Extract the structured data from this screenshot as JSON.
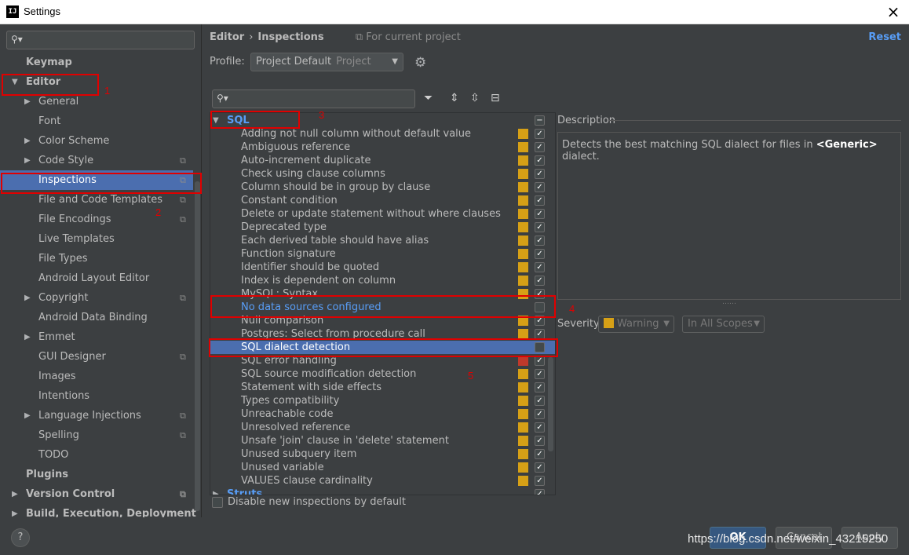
{
  "window": {
    "title": "Settings",
    "app_icon_text": "IJ",
    "close_label": "×"
  },
  "sidebar": {
    "items": [
      {
        "label": "Keymap",
        "level": 0,
        "bold": true,
        "arrow": "",
        "copy": false,
        "selected": false
      },
      {
        "label": "Editor",
        "level": 0,
        "bold": true,
        "arrow": "▼",
        "copy": false,
        "selected": false
      },
      {
        "label": "General",
        "level": 1,
        "bold": false,
        "arrow": "▶",
        "copy": false,
        "selected": false
      },
      {
        "label": "Font",
        "level": 1,
        "bold": false,
        "arrow": "",
        "copy": false,
        "selected": false
      },
      {
        "label": "Color Scheme",
        "level": 1,
        "bold": false,
        "arrow": "▶",
        "copy": false,
        "selected": false
      },
      {
        "label": "Code Style",
        "level": 1,
        "bold": false,
        "arrow": "▶",
        "copy": true,
        "selected": false
      },
      {
        "label": "Inspections",
        "level": 1,
        "bold": false,
        "arrow": "",
        "copy": true,
        "selected": true
      },
      {
        "label": "File and Code Templates",
        "level": 1,
        "bold": false,
        "arrow": "",
        "copy": true,
        "selected": false
      },
      {
        "label": "File Encodings",
        "level": 1,
        "bold": false,
        "arrow": "",
        "copy": true,
        "selected": false
      },
      {
        "label": "Live Templates",
        "level": 1,
        "bold": false,
        "arrow": "",
        "copy": false,
        "selected": false
      },
      {
        "label": "File Types",
        "level": 1,
        "bold": false,
        "arrow": "",
        "copy": false,
        "selected": false
      },
      {
        "label": "Android Layout Editor",
        "level": 1,
        "bold": false,
        "arrow": "",
        "copy": false,
        "selected": false
      },
      {
        "label": "Copyright",
        "level": 1,
        "bold": false,
        "arrow": "▶",
        "copy": true,
        "selected": false
      },
      {
        "label": "Android Data Binding",
        "level": 1,
        "bold": false,
        "arrow": "",
        "copy": false,
        "selected": false
      },
      {
        "label": "Emmet",
        "level": 1,
        "bold": false,
        "arrow": "▶",
        "copy": false,
        "selected": false
      },
      {
        "label": "GUI Designer",
        "level": 1,
        "bold": false,
        "arrow": "",
        "copy": true,
        "selected": false
      },
      {
        "label": "Images",
        "level": 1,
        "bold": false,
        "arrow": "",
        "copy": false,
        "selected": false
      },
      {
        "label": "Intentions",
        "level": 1,
        "bold": false,
        "arrow": "",
        "copy": false,
        "selected": false
      },
      {
        "label": "Language Injections",
        "level": 1,
        "bold": false,
        "arrow": "▶",
        "copy": true,
        "selected": false
      },
      {
        "label": "Spelling",
        "level": 1,
        "bold": false,
        "arrow": "",
        "copy": true,
        "selected": false
      },
      {
        "label": "TODO",
        "level": 1,
        "bold": false,
        "arrow": "",
        "copy": false,
        "selected": false
      },
      {
        "label": "Plugins",
        "level": 0,
        "bold": true,
        "arrow": "",
        "copy": false,
        "selected": false
      },
      {
        "label": "Version Control",
        "level": 0,
        "bold": true,
        "arrow": "▶",
        "copy": true,
        "selected": false
      },
      {
        "label": "Build, Execution, Deployment",
        "level": 0,
        "bold": true,
        "arrow": "▶",
        "copy": false,
        "selected": false
      }
    ]
  },
  "header": {
    "crumb_editor": "Editor",
    "crumb_sep": "›",
    "crumb_inspections": "Inspections",
    "for_project": "For current project",
    "reset": "Reset"
  },
  "profile": {
    "label": "Profile:",
    "value": "Project Default",
    "sub": "Project"
  },
  "inspections": {
    "rows": [
      {
        "label": "SQL",
        "group": true,
        "arrow": "▼",
        "severity": "none",
        "check": "partial",
        "selected": false,
        "link": false
      },
      {
        "label": "Adding not null column without default value",
        "severity": "warning",
        "check": "on"
      },
      {
        "label": "Ambiguous reference",
        "severity": "warning",
        "check": "on"
      },
      {
        "label": "Auto-increment duplicate",
        "severity": "warning",
        "check": "on"
      },
      {
        "label": "Check using clause columns",
        "severity": "warning",
        "check": "on"
      },
      {
        "label": "Column should be in group by clause",
        "severity": "warning",
        "check": "on"
      },
      {
        "label": "Constant condition",
        "severity": "warning",
        "check": "on"
      },
      {
        "label": "Delete or update statement without where clauses",
        "severity": "warning",
        "check": "on"
      },
      {
        "label": "Deprecated type",
        "severity": "warning",
        "check": "on"
      },
      {
        "label": "Each derived table should have alias",
        "severity": "warning",
        "check": "on"
      },
      {
        "label": "Function signature",
        "severity": "warning",
        "check": "on"
      },
      {
        "label": "Identifier should be quoted",
        "severity": "warning",
        "check": "on"
      },
      {
        "label": "Index is dependent on column",
        "severity": "warning",
        "check": "on"
      },
      {
        "label": "MySQL: Syntax",
        "severity": "warning",
        "check": "on"
      },
      {
        "label": "No data sources configured",
        "severity": "none",
        "check": "off",
        "link": true
      },
      {
        "label": "Null comparison",
        "severity": "warning",
        "check": "on"
      },
      {
        "label": "Postgres: Select from procedure call",
        "severity": "warning",
        "check": "on"
      },
      {
        "label": "SQL dialect detection",
        "severity": "none",
        "check": "off",
        "selected": true
      },
      {
        "label": "SQL error handling",
        "severity": "error",
        "check": "on"
      },
      {
        "label": "SQL source modification detection",
        "severity": "warning",
        "check": "on"
      },
      {
        "label": "Statement with side effects",
        "severity": "warning",
        "check": "on"
      },
      {
        "label": "Types compatibility",
        "severity": "warning",
        "check": "on"
      },
      {
        "label": "Unreachable code",
        "severity": "warning",
        "check": "on"
      },
      {
        "label": "Unresolved reference",
        "severity": "warning",
        "check": "on"
      },
      {
        "label": "Unsafe 'join' clause in 'delete' statement",
        "severity": "warning",
        "check": "on"
      },
      {
        "label": "Unused subquery item",
        "severity": "warning",
        "check": "on"
      },
      {
        "label": "Unused variable",
        "severity": "warning",
        "check": "on"
      },
      {
        "label": "VALUES clause cardinality",
        "severity": "warning",
        "check": "on"
      },
      {
        "label": "Struts",
        "group": true,
        "arrow": "▶",
        "severity": "none",
        "check": "on"
      }
    ]
  },
  "description": {
    "label": "Description",
    "text_before": "Detects the best matching SQL dialect for files in ",
    "text_bold": "<Generic>",
    "text_after": " dialect."
  },
  "severity": {
    "label": "Severity:",
    "value": "Warning",
    "scope": "In All Scopes"
  },
  "footer": {
    "disable_label": "Disable new inspections by default",
    "help": "?",
    "ok": "OK",
    "cancel": "Cancel",
    "apply": "Apply",
    "watermark": "https://blog.csdn.net/weixin_43215250"
  },
  "annotations": [
    "1",
    "2",
    "3",
    "4",
    "5"
  ],
  "colors": {
    "accent": "#589df6",
    "selection": "#4b6eaf",
    "warning": "#d6a016",
    "error": "#c0392b",
    "annotation": "#e00000"
  }
}
